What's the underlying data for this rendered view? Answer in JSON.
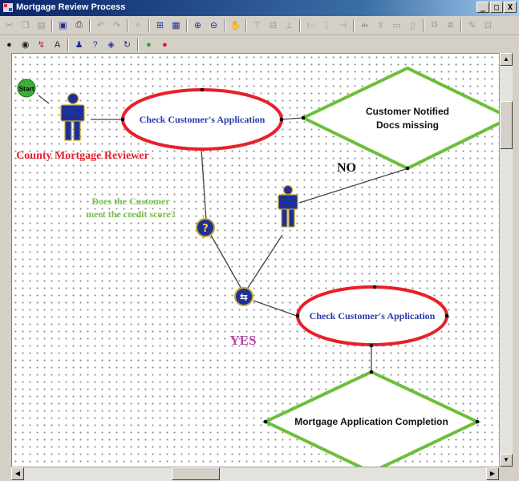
{
  "window": {
    "title": "Mortgage Review Process",
    "controls": [
      "_",
      "□",
      "X"
    ]
  },
  "toolbar1_icons": [
    "cut-icon",
    "copy-icon",
    "paste-icon",
    "|",
    "save-icon",
    "print-icon",
    "|",
    "undo-icon",
    "redo-icon",
    "|",
    "preview-icon",
    "|",
    "fit-icon",
    "grid-icon",
    "|",
    "zoom-in-icon",
    "zoom-out-icon",
    "|",
    "pan-icon",
    "|",
    "align-top-icon",
    "align-middle-icon",
    "align-bottom-icon",
    "|",
    "align-left-icon",
    "align-center-icon",
    "align-right-icon",
    "|",
    "space-h-icon",
    "space-v-icon",
    "same-width-icon",
    "same-height-icon",
    "|",
    "group-icon",
    "ungroup-icon",
    "|",
    "properties-icon",
    "layout-icon"
  ],
  "toolbar2_icons": [
    "start-tool-icon",
    "end-tool-icon",
    "connector-tool-icon",
    "text-tool-icon",
    "|",
    "actor-tool-icon",
    "decision-tool-icon",
    "merge-tool-icon",
    "loop-tool-icon",
    "|",
    "green-node-icon",
    "red-node-icon"
  ],
  "diagram": {
    "start_label": "Start",
    "actor1_label": "County Mortgage Reviewer",
    "activity1_label": "Check Customer's Application",
    "diamond1_label_line1": "Customer Notified",
    "diamond1_label_line2": "Docs missing",
    "no_label": "NO",
    "question_line1": "Does the Customer",
    "question_line2": "meet the credit score?",
    "yes_label": "YES",
    "activity2_label": "Check Customer's Application",
    "diamond2_label": "Mortgage Application Completion",
    "decision_glyph": "?",
    "merge_glyph": "⇆"
  },
  "colors": {
    "ellipse_stroke": "#e8202a",
    "activity_text": "#2a3aa8",
    "diamond_stroke": "#6cbf3a",
    "actor_label": "#e8202a",
    "question_text": "#7ac04a",
    "yes_text": "#b84aa8",
    "actor_fill": "#1e2f9a",
    "start_fill": "#3ab03a"
  }
}
